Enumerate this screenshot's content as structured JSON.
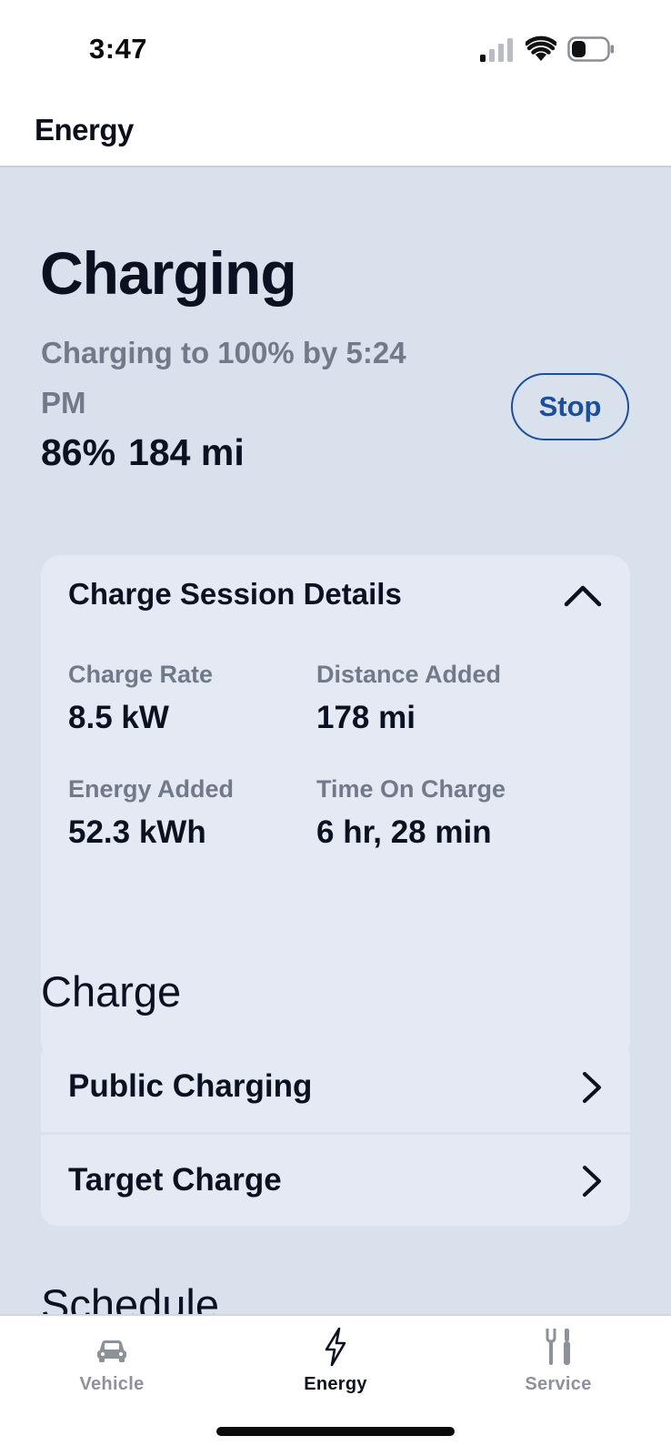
{
  "status_bar": {
    "time": "3:47"
  },
  "header": {
    "title": "Energy"
  },
  "charging": {
    "title": "Charging",
    "subtitle": "Charging to 100% by 5:24 PM",
    "battery_percent": "86%",
    "range": "184 mi",
    "stop_label": "Stop"
  },
  "session": {
    "title": "Charge Session Details",
    "details": [
      {
        "label": "Charge Rate",
        "value": "8.5 kW"
      },
      {
        "label": "Distance Added",
        "value": "178 mi"
      },
      {
        "label": "Energy Added",
        "value": "52.3 kWh"
      },
      {
        "label": "Time On Charge",
        "value": "6 hr, 28 min"
      }
    ]
  },
  "charge_section": {
    "title": "Charge",
    "items": [
      {
        "label": "Public Charging"
      },
      {
        "label": "Target Charge"
      }
    ],
    "next_section_peek": "Schedule"
  },
  "tabs": [
    {
      "label": "Vehicle",
      "icon": "car-icon",
      "active": false
    },
    {
      "label": "Energy",
      "icon": "lightning-icon",
      "active": true
    },
    {
      "label": "Service",
      "icon": "tools-icon",
      "active": false
    }
  ],
  "colors": {
    "background": "#d9e1ed",
    "card": "#e4e9f3",
    "accent": "#1b4f9c",
    "muted_text": "#717a89",
    "primary_text": "#0c1121"
  }
}
